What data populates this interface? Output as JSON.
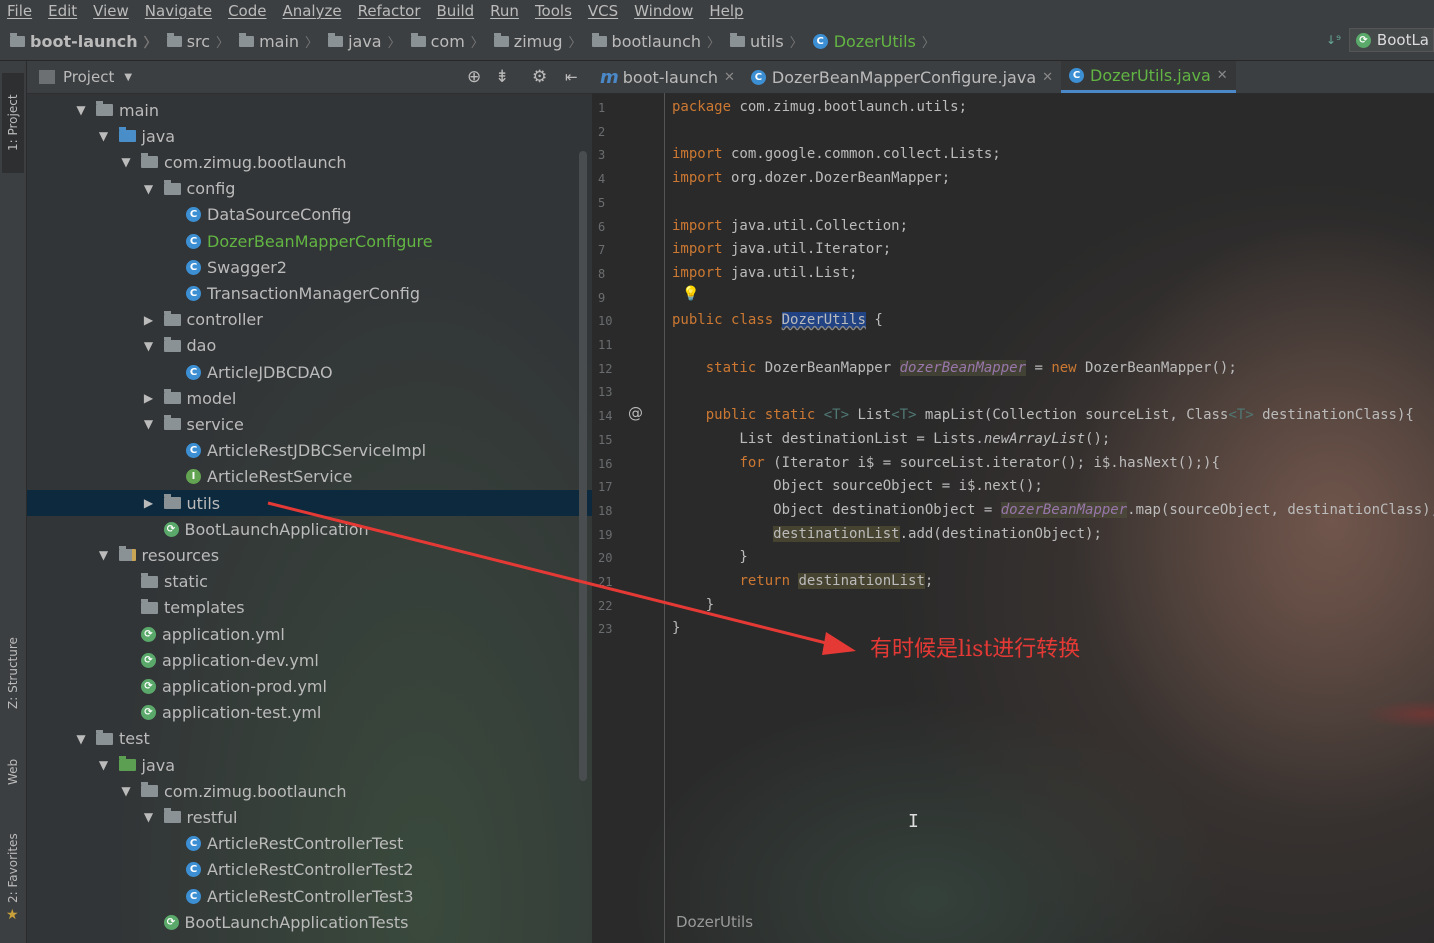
{
  "menu": [
    "File",
    "Edit",
    "View",
    "Navigate",
    "Code",
    "Analyze",
    "Refactor",
    "Build",
    "Run",
    "Tools",
    "VCS",
    "Window",
    "Help"
  ],
  "breadcrumb": [
    "boot-launch",
    "src",
    "main",
    "java",
    "com",
    "zimug",
    "bootlaunch",
    "utils",
    "DozerUtils"
  ],
  "run_config": "BootLa",
  "side_tabs": {
    "project": "1: Project",
    "structure": "Z: Structure",
    "web": "Web",
    "favorites": "2: Favorites"
  },
  "project_panel": {
    "title": "Project"
  },
  "tree": [
    {
      "label": "main",
      "indent": 2,
      "arrow": "▼",
      "icon": "dir"
    },
    {
      "label": "java",
      "indent": 3,
      "arrow": "▼",
      "icon": "dir-blue"
    },
    {
      "label": "com.zimug.bootlaunch",
      "indent": 4,
      "arrow": "▼",
      "icon": "dir"
    },
    {
      "label": "config",
      "indent": 5,
      "arrow": "▼",
      "icon": "dir"
    },
    {
      "label": "DataSourceConfig",
      "indent": 6,
      "arrow": "",
      "icon": "class"
    },
    {
      "label": "DozerBeanMapperConfigure",
      "indent": 6,
      "arrow": "",
      "icon": "class",
      "green": true
    },
    {
      "label": "Swagger2",
      "indent": 6,
      "arrow": "",
      "icon": "class"
    },
    {
      "label": "TransactionManagerConfig",
      "indent": 6,
      "arrow": "",
      "icon": "class"
    },
    {
      "label": "controller",
      "indent": 5,
      "arrow": "▶",
      "icon": "dir"
    },
    {
      "label": "dao",
      "indent": 5,
      "arrow": "▼",
      "icon": "dir"
    },
    {
      "label": "ArticleJDBCDAO",
      "indent": 6,
      "arrow": "",
      "icon": "class"
    },
    {
      "label": "model",
      "indent": 5,
      "arrow": "▶",
      "icon": "dir"
    },
    {
      "label": "service",
      "indent": 5,
      "arrow": "▼",
      "icon": "dir"
    },
    {
      "label": "ArticleRestJDBCServiceImpl",
      "indent": 6,
      "arrow": "",
      "icon": "class"
    },
    {
      "label": "ArticleRestService",
      "indent": 6,
      "arrow": "",
      "icon": "iface"
    },
    {
      "label": "utils",
      "indent": 5,
      "arrow": "▶",
      "icon": "dir",
      "selected": true
    },
    {
      "label": "BootLaunchApplication",
      "indent": 5,
      "arrow": "",
      "icon": "spring"
    },
    {
      "label": "resources",
      "indent": 3,
      "arrow": "▼",
      "icon": "dir-res"
    },
    {
      "label": "static",
      "indent": 4,
      "arrow": "",
      "icon": "dir"
    },
    {
      "label": "templates",
      "indent": 4,
      "arrow": "",
      "icon": "dir"
    },
    {
      "label": "application.yml",
      "indent": 4,
      "arrow": "",
      "icon": "spring"
    },
    {
      "label": "application-dev.yml",
      "indent": 4,
      "arrow": "",
      "icon": "spring"
    },
    {
      "label": "application-prod.yml",
      "indent": 4,
      "arrow": "",
      "icon": "spring"
    },
    {
      "label": "application-test.yml",
      "indent": 4,
      "arrow": "",
      "icon": "spring"
    },
    {
      "label": "test",
      "indent": 2,
      "arrow": "▼",
      "icon": "dir"
    },
    {
      "label": "java",
      "indent": 3,
      "arrow": "▼",
      "icon": "dir-green"
    },
    {
      "label": "com.zimug.bootlaunch",
      "indent": 4,
      "arrow": "▼",
      "icon": "dir"
    },
    {
      "label": "restful",
      "indent": 5,
      "arrow": "▼",
      "icon": "dir"
    },
    {
      "label": "ArticleRestControllerTest",
      "indent": 6,
      "arrow": "",
      "icon": "class"
    },
    {
      "label": "ArticleRestControllerTest2",
      "indent": 6,
      "arrow": "",
      "icon": "class"
    },
    {
      "label": "ArticleRestControllerTest3",
      "indent": 6,
      "arrow": "",
      "icon": "class"
    },
    {
      "label": "BootLaunchApplicationTests",
      "indent": 5,
      "arrow": "",
      "icon": "spring"
    }
  ],
  "editor_tabs": [
    {
      "label": "boot-launch",
      "icon": "m"
    },
    {
      "label": "DozerBeanMapperConfigure.java",
      "icon": "class"
    },
    {
      "label": "DozerUtils.java",
      "icon": "class",
      "active": true
    }
  ],
  "code": [
    "package com.zimug.bootlaunch.utils;",
    "",
    "import com.google.common.collect.Lists;",
    "import org.dozer.DozerBeanMapper;",
    "",
    "import java.util.Collection;",
    "import java.util.Iterator;",
    "import java.util.List;",
    "",
    "public class DozerUtils {",
    "",
    "    static DozerBeanMapper dozerBeanMapper = new DozerBeanMapper();",
    "",
    "    public static <T> List<T> mapList(Collection sourceList, Class<T> destinationClass){",
    "        List destinationList = Lists.newArrayList();",
    "        for (Iterator i$ = sourceList.iterator(); i$.hasNext();){",
    "            Object sourceObject = i$.next();",
    "            Object destinationObject = dozerBeanMapper.map(sourceObject, destinationClass);",
    "            destinationList.add(destinationObject);",
    "        }",
    "        return destinationList;",
    "    }",
    "}"
  ],
  "breadcrumb_bottom": "DozerUtils",
  "annotation_text": "有时候是list进行转换",
  "colors": {
    "keyword": "#cc7832",
    "annotation": "#e53935",
    "selection": "#0d293e"
  }
}
